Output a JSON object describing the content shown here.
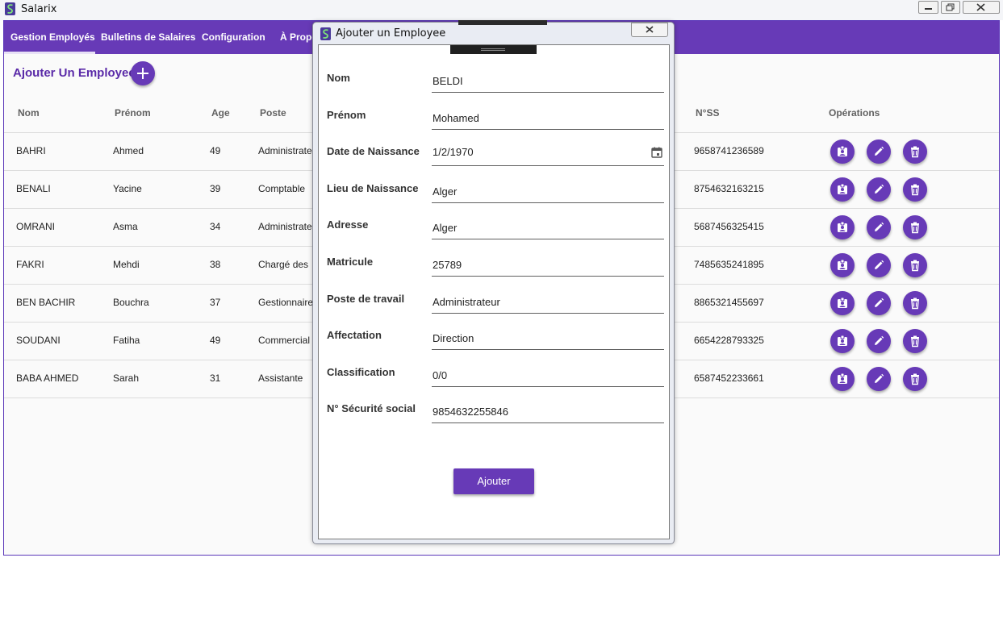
{
  "window": {
    "title": "Salarix"
  },
  "nav": {
    "tabs": [
      {
        "label": "Gestion Employés"
      },
      {
        "label": "Bulletins de Salaires"
      },
      {
        "label": "Configuration"
      },
      {
        "label": "À Propos"
      }
    ]
  },
  "page": {
    "add_title": "Ajouter Un Employee"
  },
  "table": {
    "columns": [
      "Nom",
      "Prénom",
      "Age",
      "Poste",
      "N°SS",
      "Opérations"
    ],
    "rows": [
      {
        "nom": "BAHRI",
        "prenom": "Ahmed",
        "age": "49",
        "poste": "Administrateur",
        "nss": "9658741236589"
      },
      {
        "nom": "BENALI",
        "prenom": "Yacine",
        "age": "39",
        "poste": "Comptable",
        "nss": "8754632163215"
      },
      {
        "nom": "OMRANI",
        "prenom": "Asma",
        "age": "34",
        "poste": "Administrateur",
        "nss": "5687456325415"
      },
      {
        "nom": "FAKRI",
        "prenom": "Mehdi",
        "age": "38",
        "poste": "Chargé des",
        "nss": "7485635241895"
      },
      {
        "nom": "BEN BACHIR",
        "prenom": "Bouchra",
        "age": "37",
        "poste": "Gestionnaire",
        "nss": "8865321455697"
      },
      {
        "nom": "SOUDANI",
        "prenom": "Fatiha",
        "age": "49",
        "poste": "Commercial",
        "nss": "6654228793325"
      },
      {
        "nom": "BABA AHMED",
        "prenom": "Sarah",
        "age": "31",
        "poste": "Assistante",
        "nss": "6587452233661"
      }
    ],
    "operation_icons": [
      "badge-icon",
      "pencil-icon",
      "trash-icon"
    ]
  },
  "dialog": {
    "title": "Ajouter un Employee",
    "fields": [
      {
        "label": "Nom",
        "value": "BELDI"
      },
      {
        "label": "Prénom",
        "value": "Mohamed"
      },
      {
        "label": "Date de Naissance",
        "value": "1/2/1970"
      },
      {
        "label": "Lieu de Naissance",
        "value": "Alger"
      },
      {
        "label": "Adresse",
        "value": "Alger"
      },
      {
        "label": "Matricule",
        "value": "25789"
      },
      {
        "label": "Poste de travail",
        "value": "Administrateur"
      },
      {
        "label": "Affectation",
        "value": "Direction"
      },
      {
        "label": "Classification",
        "value": "0/0"
      },
      {
        "label": "N° Sécurité social",
        "value": "9854632255846"
      }
    ],
    "submit_label": "Ajouter"
  },
  "colors": {
    "accent": "#673ab7",
    "title_purple": "#5a2aa8"
  }
}
